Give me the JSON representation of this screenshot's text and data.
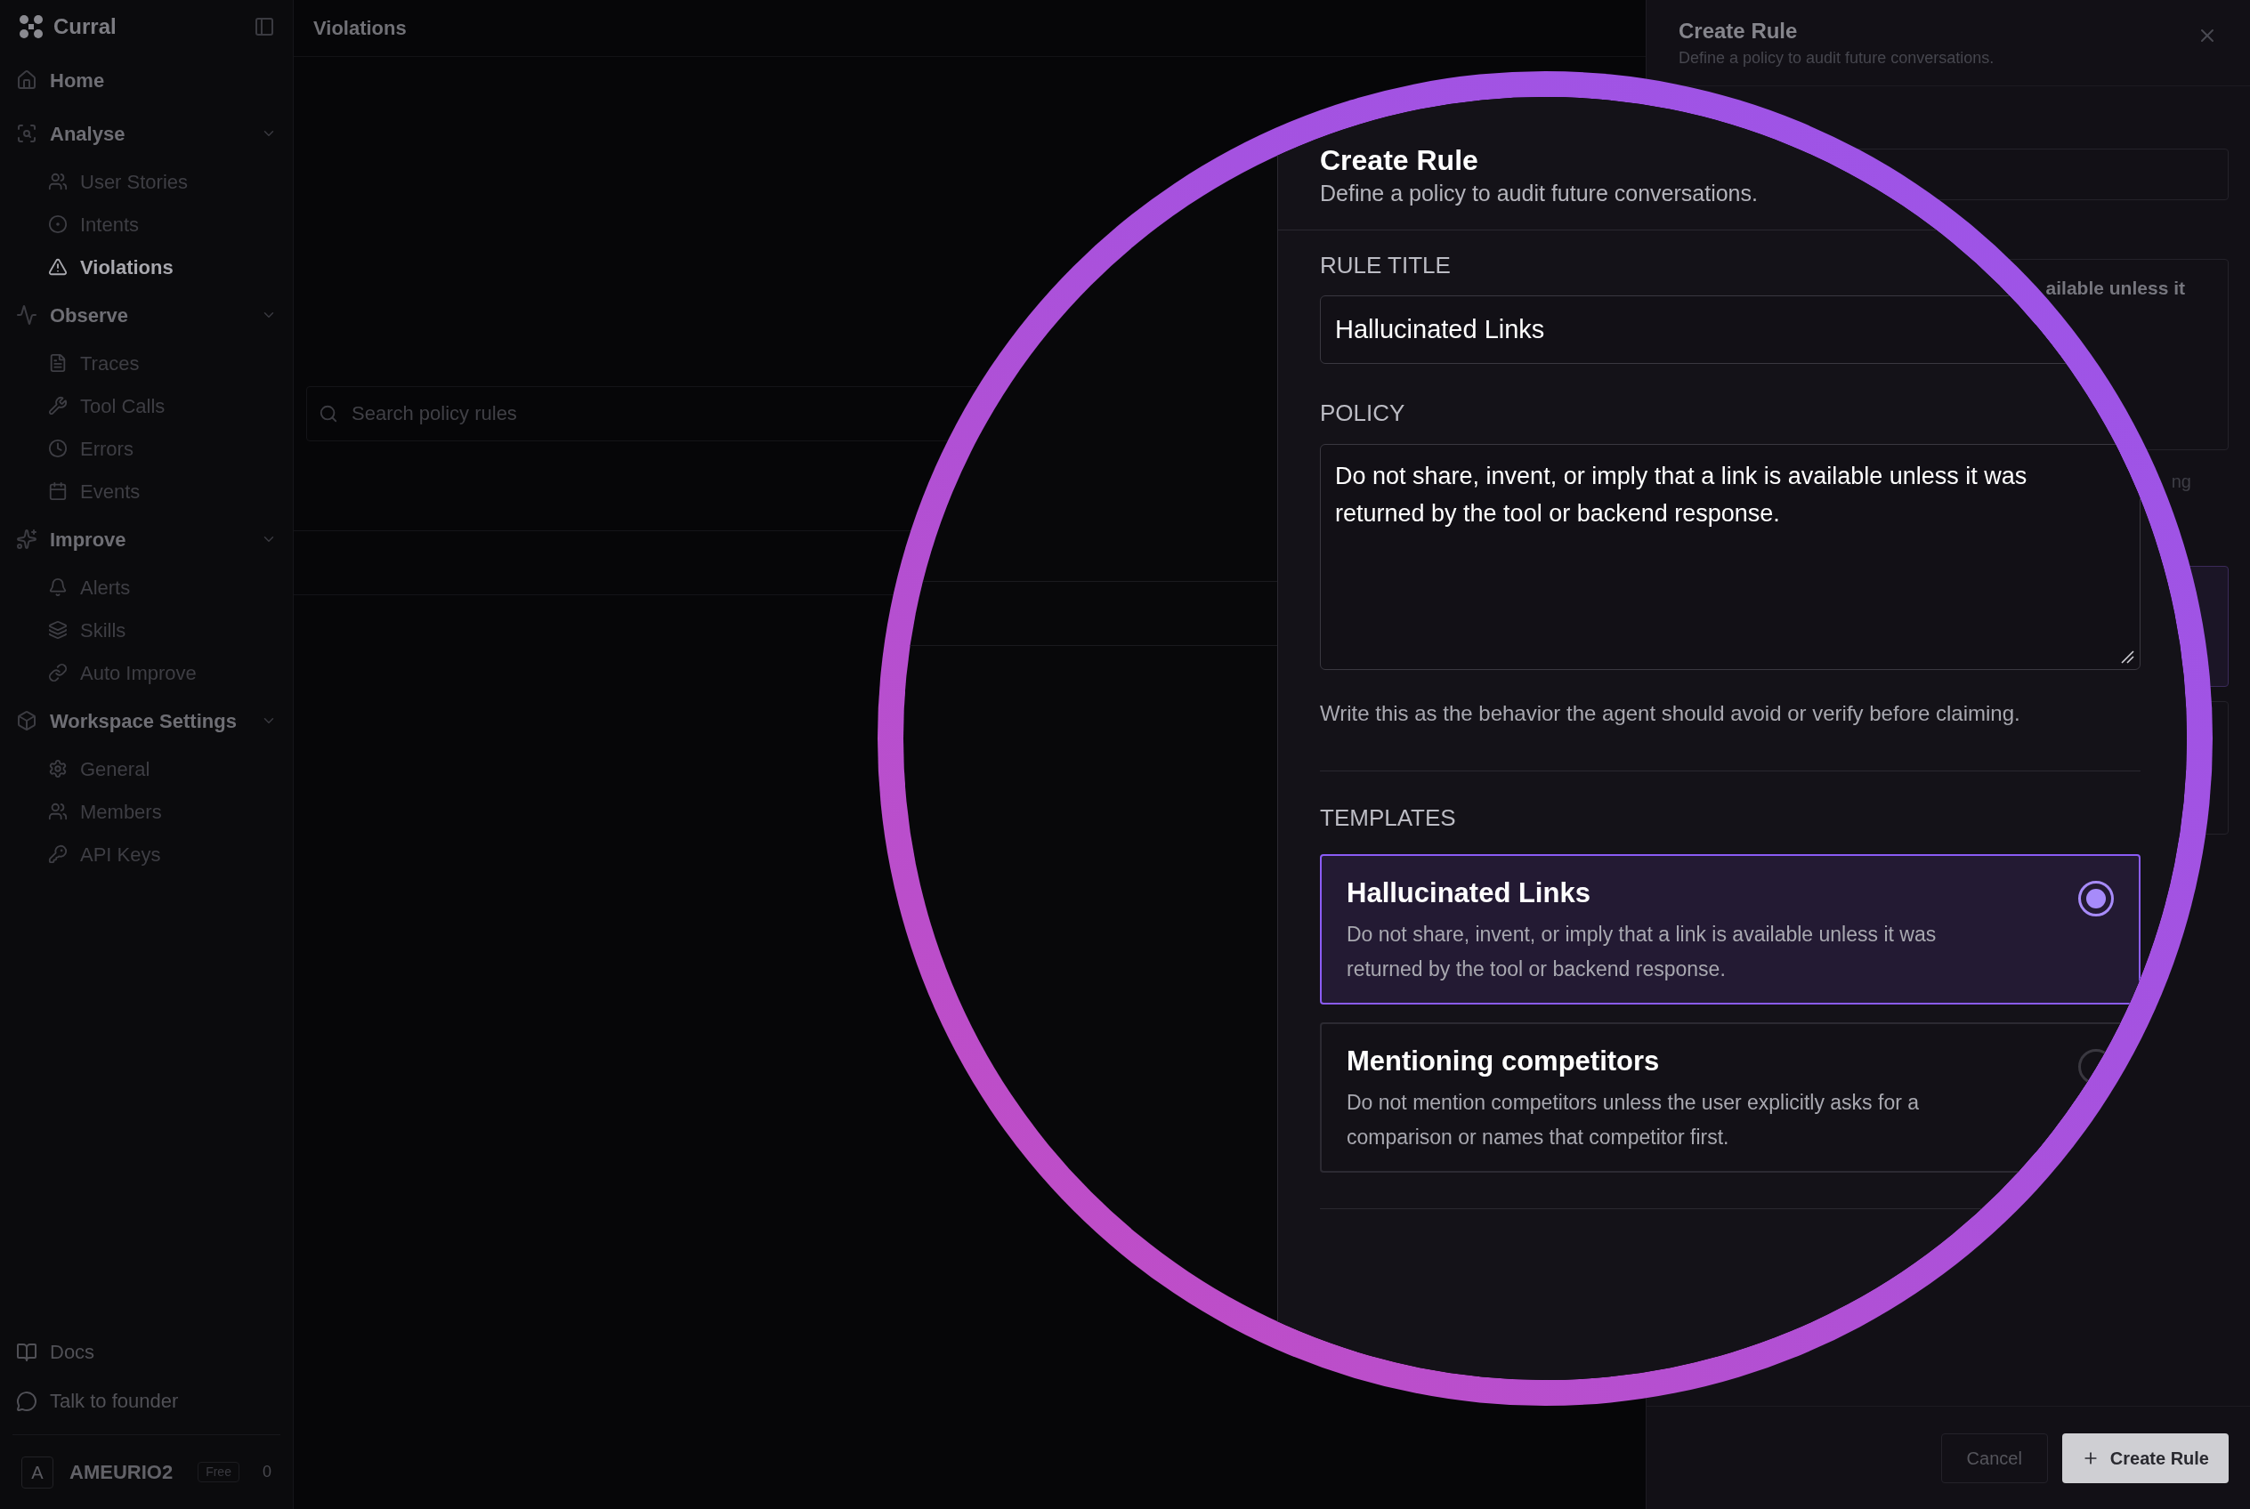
{
  "sidebar": {
    "brand": "Curral",
    "groups": [
      {
        "label": "Home",
        "kind": "link"
      },
      {
        "label": "Analyse",
        "kind": "group",
        "items": [
          {
            "label": "User Stories",
            "selected": false
          },
          {
            "label": "Intents",
            "selected": false
          },
          {
            "label": "Violations",
            "selected": true
          }
        ]
      },
      {
        "label": "Observe",
        "kind": "group",
        "items": [
          {
            "label": "Traces",
            "selected": false
          },
          {
            "label": "Tool Calls",
            "selected": false
          },
          {
            "label": "Errors",
            "selected": false
          },
          {
            "label": "Events",
            "selected": false
          }
        ]
      },
      {
        "label": "Improve",
        "kind": "group",
        "items": [
          {
            "label": "Alerts",
            "selected": false
          },
          {
            "label": "Skills",
            "selected": false
          },
          {
            "label": "Auto Improve",
            "selected": false
          }
        ]
      },
      {
        "label": "Workspace Settings",
        "kind": "group",
        "items": [
          {
            "label": "General",
            "selected": false
          },
          {
            "label": "Members",
            "selected": false
          },
          {
            "label": "API Keys",
            "selected": false
          }
        ]
      }
    ],
    "footer_links": [
      "Docs",
      "Talk to founder"
    ],
    "account": {
      "avatar": "A",
      "name": "AMEURIO2",
      "plan": "Free",
      "count": "0"
    }
  },
  "main": {
    "title": "Violations",
    "search": {
      "placeholder": "Search policy rules"
    }
  },
  "drawer": {
    "title": "Create Rule",
    "subtitle": "Define a policy to audit future conversations.",
    "policy_fragment": "ailable unless it",
    "hint_fragment": "ng",
    "buttons": [
      {
        "label": "Cancel",
        "kind": "secondary"
      },
      {
        "label": "Create Rule",
        "kind": "primary"
      }
    ]
  },
  "magnifier": {
    "title": "Create Rule",
    "subtitle": "Define a policy to audit future conversations.",
    "title_field": {
      "label": "RULE TITLE",
      "value": "Hallucinated Links"
    },
    "policy_field": {
      "label": "POLICY",
      "value": "Do not share, invent, or imply that a link is available unless it was returned by the tool or backend response."
    },
    "hint": "Write this as the behavior the agent should avoid or verify before claiming.",
    "templates_label": "TEMPLATES",
    "templates": [
      {
        "title": "Hallucinated Links",
        "description": "Do not share, invent, or imply that a link is available unless it was returned by the tool or backend response.",
        "selected": true
      },
      {
        "title": "Mentioning competitors",
        "description": "Do not mention competitors unless the user explicitly asks for a comparison or names that competitor first.",
        "selected": false
      }
    ]
  }
}
